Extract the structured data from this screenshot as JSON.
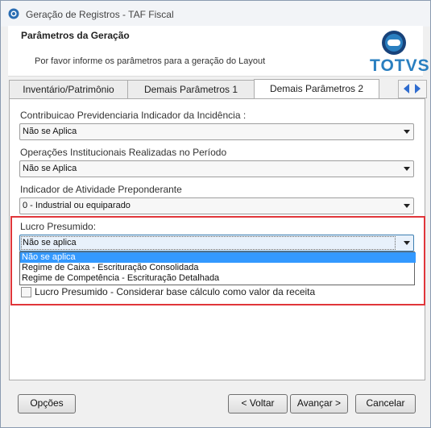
{
  "window": {
    "title": "Geração de Registros - TAF Fiscal"
  },
  "header": {
    "title": "Parâmetros da Geração",
    "subtitle": "Por favor informe os parâmetros para a geração do Layout",
    "logo_text": "TOTVS"
  },
  "tabs": [
    {
      "label": "Inventário/Patrimônio",
      "active": false
    },
    {
      "label": "Demais Parâmetros 1",
      "active": false
    },
    {
      "label": "Demais Parâmetros 2",
      "active": true
    }
  ],
  "fields": {
    "contribuicao": {
      "label": "Contribuicao Previdenciaria Indicador da Incidência :",
      "value": "Não se Aplica"
    },
    "operacoes": {
      "label": "Operações Institucionais Realizadas no Período",
      "value": "Não se Aplica"
    },
    "atividade": {
      "label": "Indicador de Atividade Preponderante",
      "value": "0 - Industrial ou equiparado"
    },
    "lucro": {
      "label": "Lucro Presumido:",
      "value": "Não se aplica",
      "options": [
        "Não se aplica",
        "Regime de Caixa - Escrituração Consolidada",
        "Regime de Competência - Escrituração Detalhada"
      ]
    }
  },
  "checkbox": {
    "label": "Lucro Presumido - Considerar base cálculo como valor da receita",
    "checked": false
  },
  "buttons": {
    "options": "Opções",
    "back": "< Voltar",
    "next": "Avançar >",
    "cancel": "Cancelar"
  },
  "colors": {
    "highlight_border": "#e0363a",
    "selection": "#3399ff",
    "logo": "#2a7fc0"
  }
}
